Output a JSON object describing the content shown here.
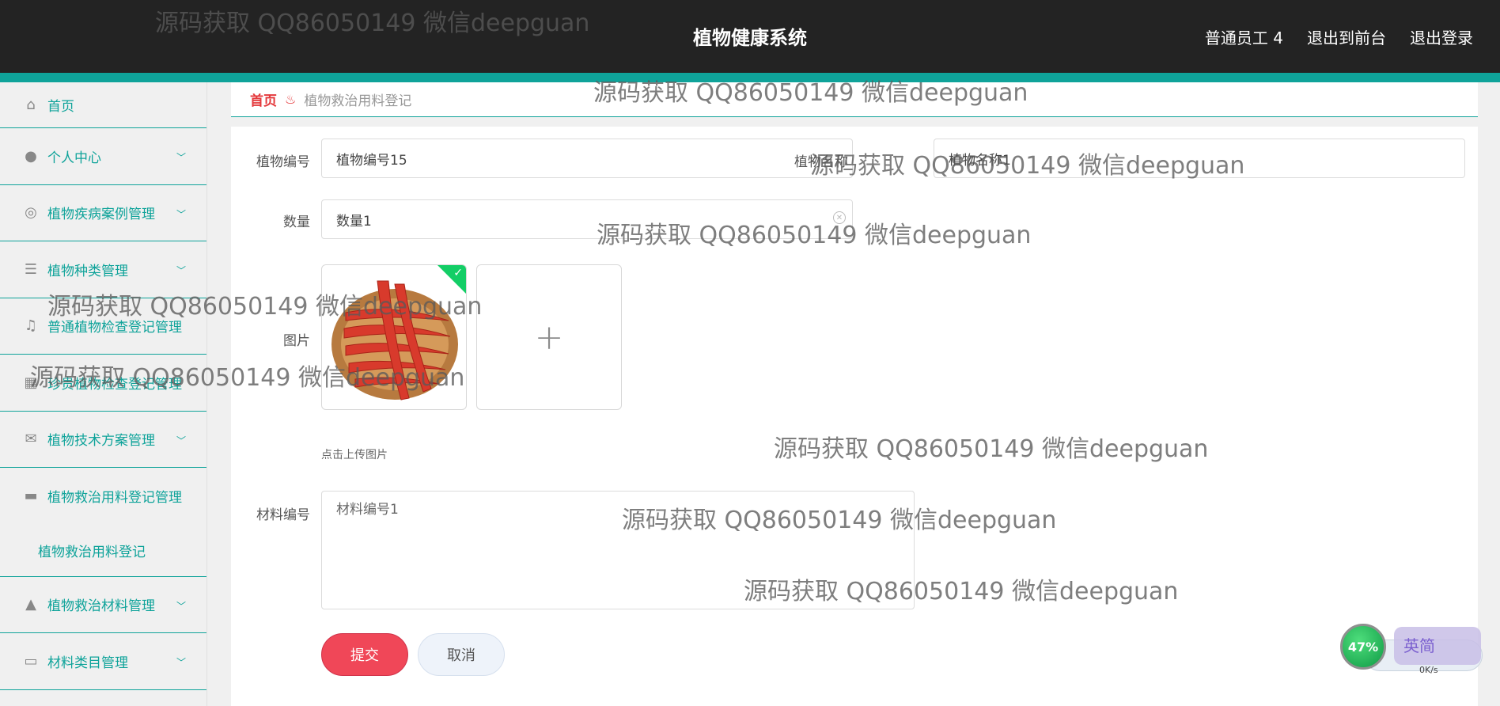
{
  "header": {
    "title": "植物健康系统",
    "user": "普通员工 4",
    "to_front": "退出到前台",
    "logout": "退出登录"
  },
  "sidebar": {
    "items": [
      {
        "label": "首页",
        "icon": "home-icon"
      },
      {
        "label": "个人中心",
        "icon": "user-icon"
      },
      {
        "label": "植物疾病案例管理",
        "icon": "lifebuoy-icon"
      },
      {
        "label": "植物种类管理",
        "icon": "list-icon"
      },
      {
        "label": "普通植物检查登记管理",
        "icon": "bell-icon"
      },
      {
        "label": "珍贵植物检查登记管理",
        "icon": "grid-icon"
      },
      {
        "label": "植物技术方案管理",
        "icon": "mail-icon"
      },
      {
        "label": "植物救治用料登记管理",
        "icon": "tray-icon"
      },
      {
        "label": "植物救治材料管理",
        "icon": "chart-icon"
      },
      {
        "label": "材料类目管理",
        "icon": "card-icon"
      }
    ],
    "sub_item": "植物救治用料登记"
  },
  "breadcrumb": {
    "home": "首页",
    "current": "植物救治用料登记"
  },
  "form": {
    "plant_no_label": "植物编号",
    "plant_no_value": "植物编号15",
    "plant_name_label": "植物名称",
    "plant_name_value": "植物名称1",
    "qty_label": "数量",
    "qty_value": "数量1",
    "image_label": "图片",
    "upload_hint": "点击上传图片",
    "material_no_label": "材料编号",
    "material_no_value": "材料编号1",
    "submit": "提交",
    "cancel": "取消"
  },
  "watermark": "源码获取 QQ86050149 微信deepguan",
  "widget": {
    "percent": "47%",
    "speed": "0K/s",
    "ime": "英简"
  },
  "colors": {
    "accent": "#0fa39a",
    "header_bg": "#232323",
    "submit": "#f04758",
    "breadcrumb_home": "#e4393c"
  }
}
